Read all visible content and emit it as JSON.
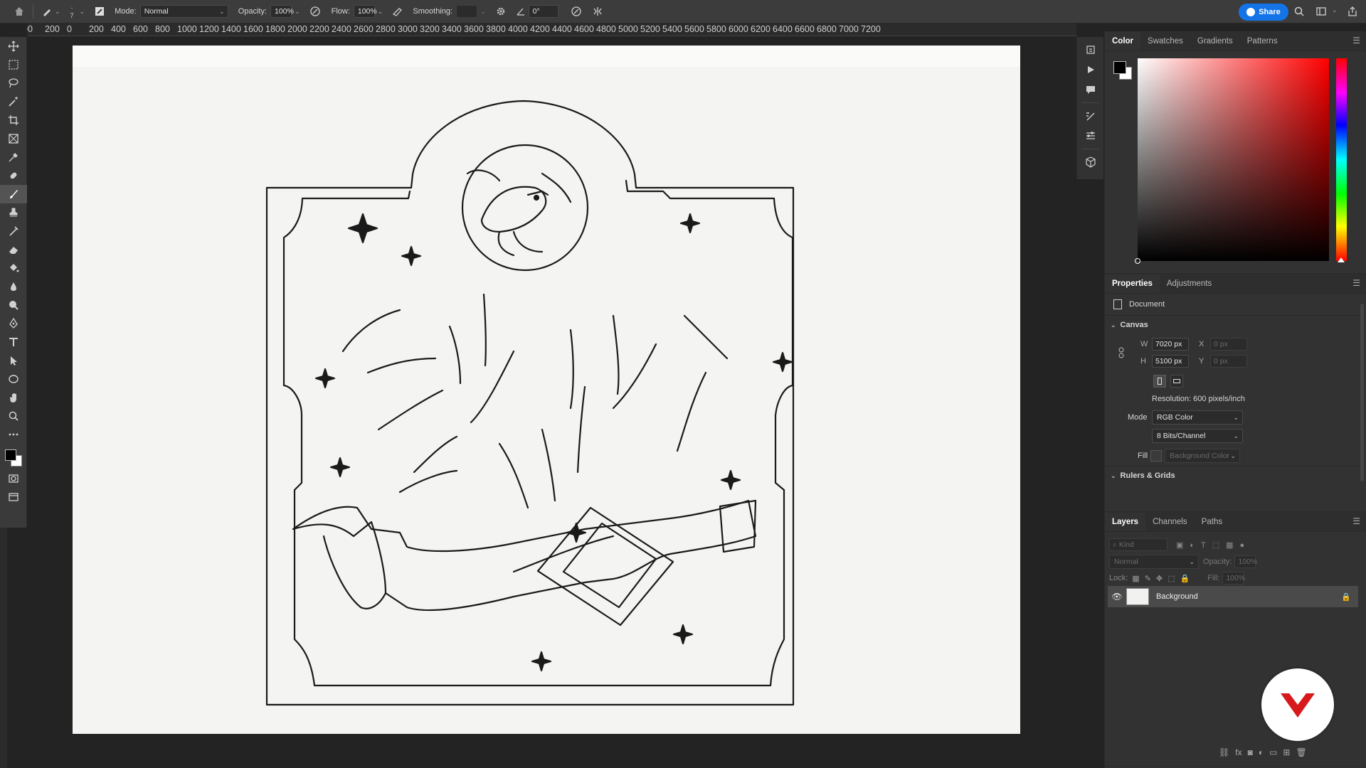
{
  "options_bar": {
    "brush_size": "7",
    "mode_label": "Mode:",
    "mode_value": "Normal",
    "opacity_label": "Opacity:",
    "opacity_value": "100%",
    "flow_label": "Flow:",
    "flow_value": "100%",
    "smoothing_label": "Smoothing:",
    "smoothing_value": "",
    "angle_value": "0°",
    "share_label": "Share"
  },
  "ruler": {
    "ticks": [
      "00",
      "200",
      "0",
      "200",
      "400",
      "600",
      "800",
      "1000",
      "1200",
      "1400",
      "1600",
      "1800",
      "2000",
      "2200",
      "2400",
      "2600",
      "2800",
      "3000",
      "3200",
      "3400",
      "3600",
      "3800",
      "4000",
      "4200",
      "4400",
      "4600",
      "4800",
      "5000",
      "5200",
      "5400",
      "5600",
      "5800",
      "6000",
      "6200",
      "6400",
      "6600",
      "6800",
      "7000",
      "7200"
    ]
  },
  "color_panel": {
    "tabs": [
      "Color",
      "Swatches",
      "Gradients",
      "Patterns"
    ],
    "foreground": "#000000",
    "background": "#ffffff"
  },
  "properties_panel": {
    "tabs": [
      "Properties",
      "Adjustments"
    ],
    "type_label": "Document",
    "canvas_section": "Canvas",
    "w_label": "W",
    "w_value": "7020 px",
    "h_label": "H",
    "h_value": "5100 px",
    "x_label": "X",
    "x_value": "0 px",
    "y_label": "Y",
    "y_value": "0 px",
    "resolution": "Resolution: 600 pixels/inch",
    "mode_label": "Mode",
    "mode_value": "RGB Color",
    "bits_value": "8 Bits/Channel",
    "fill_label": "Fill",
    "fill_value": "Background Color",
    "rulers_section": "Rulers & Grids"
  },
  "layers_panel": {
    "tabs": [
      "Layers",
      "Channels",
      "Paths"
    ],
    "kind_placeholder": "Kind",
    "blend_mode": "Normal",
    "opacity_label": "Opacity:",
    "opacity_value": "100%",
    "lock_label": "Lock:",
    "fill_label": "Fill:",
    "fill_value": "100%",
    "layers": [
      {
        "name": "Background"
      }
    ]
  },
  "colors": {
    "accent": "#1473e6",
    "badge_red": "#d7191c"
  }
}
